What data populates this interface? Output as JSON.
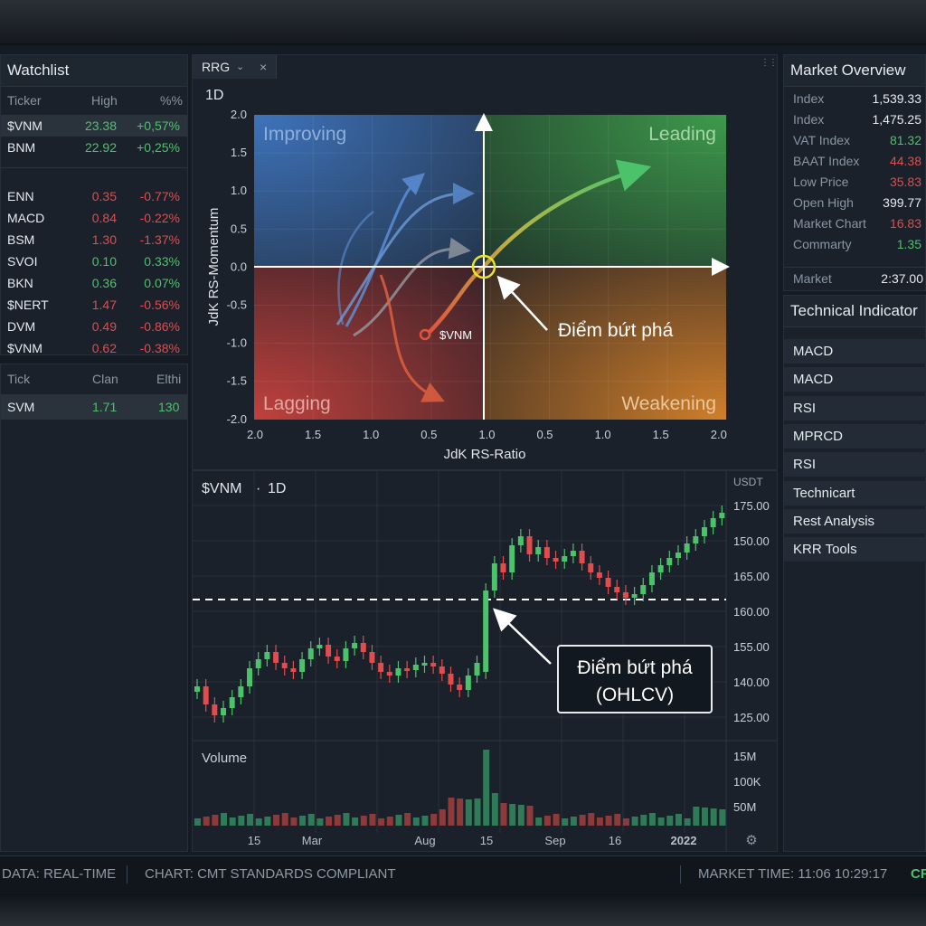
{
  "watchlist": {
    "title": "Watchlist",
    "headers": [
      "Ticker",
      "High",
      "%%"
    ],
    "rows": [
      {
        "ticker": "$VNM",
        "high": "23.38",
        "pct": "+0,57%",
        "dir": "up"
      },
      {
        "ticker": "BNM",
        "high": "22.92",
        "pct": "+0,25%",
        "dir": "up"
      },
      {
        "ticker": "ENN",
        "high": "0.35",
        "pct": "-0.77%",
        "dir": "down"
      },
      {
        "ticker": "MACD",
        "high": "0.84",
        "pct": "-0.22%",
        "dir": "down"
      },
      {
        "ticker": "BSM",
        "high": "1.30",
        "pct": "-1.37%",
        "dir": "down"
      },
      {
        "ticker": "SVOI",
        "high": "0.10",
        "pct": "0.33%",
        "dir": "up"
      },
      {
        "ticker": "BKN",
        "high": "0.36",
        "pct": "0.07%",
        "dir": "up"
      },
      {
        "ticker": "$NERT",
        "high": "1.47",
        "pct": "-0.56%",
        "dir": "down"
      },
      {
        "ticker": "DVM",
        "high": "0.49",
        "pct": "-0.86%",
        "dir": "down"
      },
      {
        "ticker": "$VNM",
        "high": "0.62",
        "pct": "-0.38%",
        "dir": "down"
      }
    ],
    "tick_headers": [
      "Tick",
      "Clan",
      "Elthi"
    ],
    "tick_row": {
      "ticker": "SVM",
      "a": "1.71",
      "b": "130"
    }
  },
  "rrg": {
    "tab_label": "RRG",
    "timeframe": "1D",
    "quadrants": [
      "Improving",
      "Leading",
      "Lagging",
      "Weakening"
    ],
    "xlabel": "JdK RS-Ratio",
    "ylabel": "JdK RS-Momentum",
    "x_ticks": [
      "2.0",
      "1.5",
      "1.0",
      "0.5",
      "1.0",
      "0.5",
      "1.0",
      "1.5",
      "2.0"
    ],
    "y_ticks": [
      "2.0",
      "1.5",
      "1.0",
      "0.5",
      "0.0",
      "-0.5",
      "-1.0",
      "-1.5",
      "-2.0"
    ],
    "point_label": "$VNM",
    "callout": "Điểm bứt phá",
    "colors": {
      "improving": "#3f6fb3",
      "leading": "#3f9a4e",
      "lagging": "#b8413e",
      "weakening": "#c4782a"
    }
  },
  "price_chart": {
    "symbol": "$VNM",
    "timeframe": "1D",
    "currency": "USDT",
    "y_ticks": [
      "175.00",
      "150.00",
      "165.00",
      "160.00",
      "155.00",
      "140.00",
      "125.00"
    ],
    "callout_line1": "Điểm bứt phá",
    "callout_line2": "(OHLCV)",
    "volume_label": "Volume",
    "volume_ticks": [
      "15M",
      "100K",
      "50M"
    ],
    "x_ticks": [
      "15",
      "Mar",
      "Aug",
      "15",
      "Sep",
      "16",
      "2022"
    ]
  },
  "market_overview": {
    "title": "Market Overview",
    "rows": [
      {
        "label": "Index",
        "value": "1,539.33",
        "color": "white"
      },
      {
        "label": "Index",
        "value": "1,475.25",
        "color": "white"
      },
      {
        "label": "VAT Index",
        "value": "81.32",
        "color": "green"
      },
      {
        "label": "BAAT Index",
        "value": "44.38",
        "color": "red"
      },
      {
        "label": "Low Price",
        "value": "35.83",
        "color": "red"
      },
      {
        "label": "Open High",
        "value": "399.77",
        "color": "white"
      },
      {
        "label": "Market Chart",
        "value": "16.83",
        "color": "red"
      },
      {
        "label": "Commarty",
        "value": "1.35",
        "color": "green"
      }
    ],
    "footer_label": "Market",
    "footer_value": "2:37.00"
  },
  "technical": {
    "title": "Technical Indicator",
    "items": [
      "MACD",
      "MACD",
      "RSI",
      "MPRCD",
      "RSI",
      "Technicart",
      "Rest Analysis",
      "KRR Tools"
    ]
  },
  "status_bar": {
    "data": "DATA: REAL-TIME",
    "chart": "CHART: CMT STANDARDS COMPLIANT",
    "time": "MARKET TIME: 11:06 10:29:17",
    "extra": "CF"
  }
}
